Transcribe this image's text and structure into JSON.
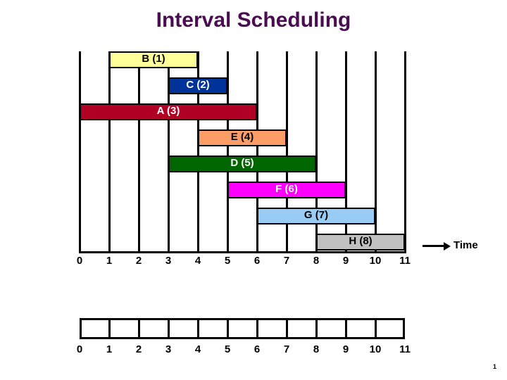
{
  "slide": {
    "title": "Interval Scheduling",
    "title_color": "#4a0d52",
    "page_number": "1"
  },
  "axis": {
    "time_label": "Time",
    "tick_labels": [
      "0",
      "1",
      "2",
      "3",
      "4",
      "5",
      "6",
      "7",
      "8",
      "9",
      "10",
      "11"
    ]
  },
  "bottom_axis": {
    "tick_labels": [
      "0",
      "1",
      "2",
      "3",
      "4",
      "5",
      "6",
      "7",
      "8",
      "9",
      "10",
      "11"
    ]
  },
  "chart_data": {
    "type": "bar",
    "title": "Interval Scheduling",
    "xlabel": "Time",
    "ylabel": "",
    "xlim": [
      0,
      11
    ],
    "grid": true,
    "legend": "none",
    "orientation": "horizontal-gantt",
    "categories": [
      "B (1)",
      "C (2)",
      "A (3)",
      "E (4)",
      "D (5)",
      "F (6)",
      "G (7)",
      "H (8)"
    ],
    "intervals": [
      {
        "label": "B (1)",
        "name": "B",
        "index": 1,
        "start": 1,
        "end": 4,
        "color": "#ffff99",
        "text_color": "#000000"
      },
      {
        "label": "C (2)",
        "name": "C",
        "index": 2,
        "start": 3,
        "end": 5,
        "color": "#003399",
        "text_color": "#ffffff"
      },
      {
        "label": "A (3)",
        "name": "A",
        "index": 3,
        "start": 0,
        "end": 6,
        "color": "#b00024",
        "text_color": "#ffffff"
      },
      {
        "label": "E (4)",
        "name": "E",
        "index": 4,
        "start": 4,
        "end": 7,
        "color": "#fc9d68",
        "text_color": "#000000"
      },
      {
        "label": "D (5)",
        "name": "D",
        "index": 5,
        "start": 3,
        "end": 8,
        "color": "#006600",
        "text_color": "#ffffff"
      },
      {
        "label": "F (6)",
        "name": "F",
        "index": 6,
        "start": 5,
        "end": 9,
        "color": "#ff00ff",
        "text_color": "#ffffff"
      },
      {
        "label": "G (7)",
        "name": "G",
        "index": 7,
        "start": 6,
        "end": 10,
        "color": "#99ccf5",
        "text_color": "#000000"
      },
      {
        "label": "H (8)",
        "name": "H",
        "index": 8,
        "start": 8,
        "end": 11,
        "color": "#c0c0c0",
        "text_color": "#000000"
      }
    ]
  }
}
